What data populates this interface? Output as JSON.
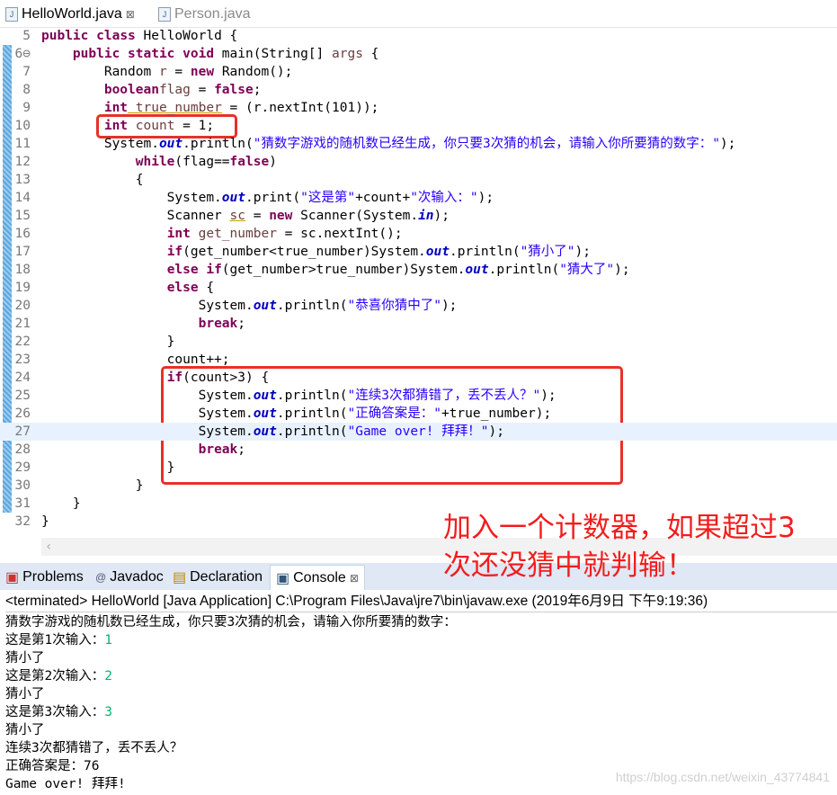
{
  "tabs": [
    {
      "label": "HelloWorld.java",
      "close": "⊠",
      "active": true
    },
    {
      "label": "Person.java",
      "active": false
    }
  ],
  "code": [
    {
      "n": "5",
      "t": [
        [
          "kw",
          "public"
        ],
        [
          "",
          "&nbsp;"
        ],
        [
          "kw",
          "class"
        ],
        [
          "",
          " HelloWorld {"
        ]
      ]
    },
    {
      "n": "6⊖",
      "t": [
        [
          "",
          "    "
        ],
        [
          "kw",
          "public static void"
        ],
        [
          "",
          " main(String[] "
        ],
        [
          "var",
          "args"
        ],
        [
          "",
          " {"
        ]
      ]
    },
    {
      "n": "7",
      "t": [
        [
          "",
          "        Random "
        ],
        [
          "var",
          "r"
        ],
        [
          "",
          " = "
        ],
        [
          "kw",
          "new"
        ],
        [
          "",
          " Random();"
        ]
      ]
    },
    {
      "n": "8",
      "t": [
        [
          "",
          "        "
        ],
        [
          "kw",
          "boolean"
        ],
        [
          " var",
          "flag"
        ],
        [
          "",
          " = "
        ],
        [
          "kw",
          "false"
        ],
        [
          "",
          ";"
        ]
      ]
    },
    {
      "n": "9",
      "t": [
        [
          "",
          "        "
        ],
        [
          "kw",
          "int"
        ],
        [
          "",
          ""
        ],
        [
          "var ul",
          " true_number"
        ],
        [
          "",
          " = (r.nextInt(101));"
        ]
      ]
    },
    {
      "n": "10",
      "t": [
        [
          "",
          "        "
        ],
        [
          "kw",
          "int"
        ],
        [
          "var",
          " count"
        ],
        [
          "",
          " = 1;"
        ]
      ]
    },
    {
      "n": "11",
      "t": [
        [
          "",
          "        System."
        ],
        [
          "fld",
          "out"
        ],
        [
          "",
          ".println("
        ],
        [
          "str",
          "\"猜数字游戏的随机数已经生成，你只要3次猜的机会，请输入你所要猜的数字：\""
        ],
        [
          "",
          ");"
        ]
      ]
    },
    {
      "n": "12",
      "t": [
        [
          "",
          "            "
        ],
        [
          "kw",
          "while"
        ],
        [
          "",
          "(flag=="
        ],
        [
          "kw",
          "false"
        ],
        [
          "",
          ")"
        ]
      ]
    },
    {
      "n": "13",
      "t": [
        [
          "",
          "            {"
        ]
      ]
    },
    {
      "n": "14",
      "t": [
        [
          "",
          "                System."
        ],
        [
          "fld",
          "out"
        ],
        [
          "",
          ".print("
        ],
        [
          "str",
          "\"这是第\""
        ],
        [
          "",
          "+count+"
        ],
        [
          "str",
          "\"次输入：\""
        ],
        [
          "",
          ");"
        ]
      ]
    },
    {
      "n": "15",
      "t": [
        [
          "",
          "                Scanner "
        ],
        [
          "var ul",
          "sc"
        ],
        [
          "",
          " = "
        ],
        [
          "kw",
          "new"
        ],
        [
          "",
          " Scanner(System."
        ],
        [
          "fld",
          "in"
        ],
        [
          "",
          ");"
        ]
      ]
    },
    {
      "n": "16",
      "t": [
        [
          "",
          "                "
        ],
        [
          "kw",
          "int"
        ],
        [
          "var",
          " get_number"
        ],
        [
          "",
          " = sc.nextInt();"
        ]
      ]
    },
    {
      "n": "17",
      "t": [
        [
          "",
          "                "
        ],
        [
          "kw",
          "if"
        ],
        [
          "",
          "(get_number<true_number)System."
        ],
        [
          "fld",
          "out"
        ],
        [
          "",
          ".println("
        ],
        [
          "str",
          "\"猜小了\""
        ],
        [
          "",
          ");"
        ]
      ]
    },
    {
      "n": "18",
      "t": [
        [
          "",
          "                "
        ],
        [
          "kw",
          "else if"
        ],
        [
          "",
          "(get_number>true_number)System."
        ],
        [
          "fld",
          "out"
        ],
        [
          "",
          ".println("
        ],
        [
          "str",
          "\"猜大了\""
        ],
        [
          "",
          ");"
        ]
      ]
    },
    {
      "n": "19",
      "t": [
        [
          "",
          "                "
        ],
        [
          "kw",
          "else"
        ],
        [
          "",
          " {"
        ]
      ]
    },
    {
      "n": "20",
      "t": [
        [
          "",
          "                    System."
        ],
        [
          "fld",
          "out"
        ],
        [
          "",
          ".println("
        ],
        [
          "str",
          "\"恭喜你猜中了\""
        ],
        [
          "",
          ");"
        ]
      ]
    },
    {
      "n": "21",
      "t": [
        [
          "",
          "                    "
        ],
        [
          "kw",
          "break"
        ],
        [
          "",
          ";"
        ]
      ]
    },
    {
      "n": "22",
      "t": [
        [
          "",
          "                }"
        ]
      ]
    },
    {
      "n": "23",
      "t": [
        [
          "",
          "                count++;"
        ]
      ]
    },
    {
      "n": "24",
      "t": [
        [
          "",
          "                "
        ],
        [
          "kw",
          "if"
        ],
        [
          "",
          "(count>3) {"
        ]
      ]
    },
    {
      "n": "25",
      "t": [
        [
          "",
          "                    System."
        ],
        [
          "fld",
          "out"
        ],
        [
          "",
          ".println("
        ],
        [
          "str",
          "\"连续3次都猜错了，丢不丢人？\""
        ],
        [
          "",
          ");"
        ]
      ]
    },
    {
      "n": "26",
      "t": [
        [
          "",
          "                    System."
        ],
        [
          "fld",
          "out"
        ],
        [
          "",
          ".println("
        ],
        [
          "str",
          "\"正确答案是：\""
        ],
        [
          "",
          "+true_number);"
        ]
      ]
    },
    {
      "n": "27",
      "t": [
        [
          "",
          "                    System."
        ],
        [
          "fld",
          "out"
        ],
        [
          "",
          ".println("
        ],
        [
          "str",
          "\"Game over! 拜拜！\""
        ],
        [
          "",
          ");"
        ]
      ]
    },
    {
      "n": "28",
      "t": [
        [
          "",
          "                    "
        ],
        [
          "kw",
          "break"
        ],
        [
          "",
          ";"
        ]
      ]
    },
    {
      "n": "29",
      "t": [
        [
          "",
          "                }"
        ]
      ]
    },
    {
      "n": "30",
      "t": [
        [
          "",
          "            }"
        ]
      ]
    },
    {
      "n": "31",
      "t": [
        [
          "",
          "    }"
        ]
      ]
    },
    {
      "n": "32",
      "t": [
        [
          "",
          "}"
        ]
      ]
    }
  ],
  "annotation": [
    "加入一个计数器，如果超过3",
    "次还没猜中就判输！"
  ],
  "panel_tabs": [
    {
      "label": "Problems",
      "icon": "problems-icon"
    },
    {
      "label": "Javadoc",
      "icon": "at-icon"
    },
    {
      "label": "Declaration",
      "icon": "declaration-icon"
    },
    {
      "label": "Console",
      "icon": "console-icon",
      "close": "⊠"
    }
  ],
  "console_header": "<terminated> HelloWorld [Java Application] C:\\Program Files\\Java\\jre7\\bin\\javaw.exe (2019年6月9日 下午9:19:36)",
  "console": [
    {
      "text": "猜数字游戏的随机数已经生成，你只要3次猜的机会，请输入你所要猜的数字："
    },
    {
      "text": "这是第1次输入：",
      "input": "1"
    },
    {
      "text": "猜小了"
    },
    {
      "text": "这是第2次输入：",
      "input": "2"
    },
    {
      "text": "猜小了"
    },
    {
      "text": "这是第3次输入：",
      "input": "3"
    },
    {
      "text": "猜小了"
    },
    {
      "text": "连续3次都猜错了，丢不丢人？"
    },
    {
      "text": "正确答案是：76"
    },
    {
      "text": "Game over! 拜拜!"
    }
  ],
  "watermark": "https://blog.csdn.net/weixin_43774841",
  "colors": {
    "keyword": "#7f0055",
    "string": "#2a00ff",
    "highlight_box": "#e8302a",
    "annotation": "#f21d1d",
    "console_input": "#00b86b"
  }
}
